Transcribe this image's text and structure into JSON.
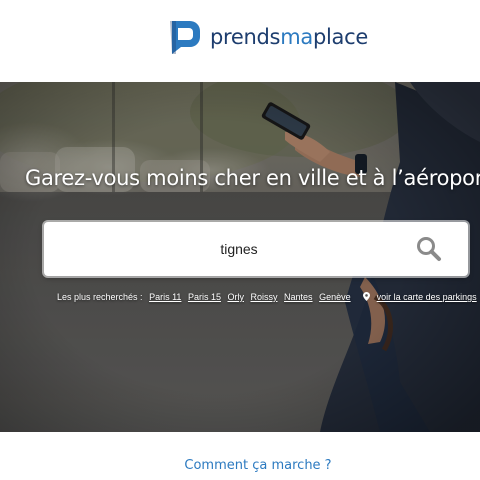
{
  "brand": {
    "name_part1": "prends",
    "name_part2": "ma",
    "name_part3": "place",
    "logo_icon": "p-logo-icon",
    "colors": {
      "dark_blue": "#1d3d6e",
      "light_blue": "#2c7ac0"
    }
  },
  "hero": {
    "title": "Garez-vous moins cher en ville et à l’aéroport"
  },
  "search": {
    "value": "tignes",
    "icon": "search-icon"
  },
  "popular": {
    "label": "Les plus recherchés :",
    "links": [
      "Paris 11",
      "Paris 15",
      "Orly",
      "Roissy",
      "Nantes",
      "Genève"
    ],
    "map_link": "voir la carte des parkings",
    "map_icon": "map-pin-icon"
  },
  "footer": {
    "how_it_works": "Comment ça marche ?"
  }
}
